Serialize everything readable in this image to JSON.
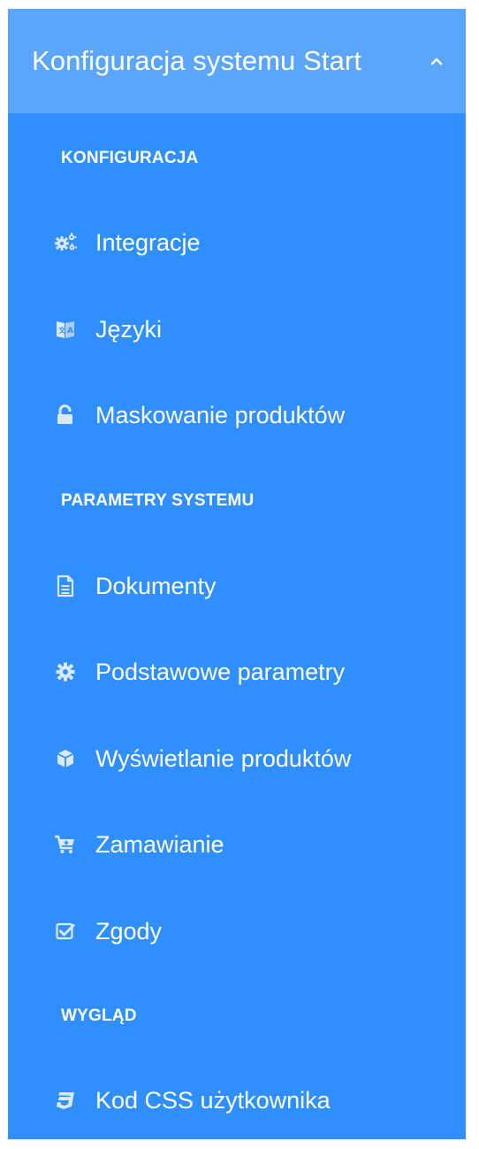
{
  "panel": {
    "title": "Konfiguracja systemu Start",
    "expanded": true,
    "chevron_icon": "chevron-up-icon",
    "colors": {
      "background": "#2f8ffd",
      "header_background": "#5aa6fd",
      "text": "#ffffff",
      "icon": "#dbe9ff"
    }
  },
  "sections": [
    {
      "label": "KONFIGURACJA",
      "items": [
        {
          "label": "Integracje",
          "icon": "gears-icon"
        },
        {
          "label": "Języki",
          "icon": "language-icon"
        },
        {
          "label": "Maskowanie produktów",
          "icon": "unlock-icon"
        }
      ]
    },
    {
      "label": "PARAMETRY SYSTEMU",
      "items": [
        {
          "label": "Dokumenty",
          "icon": "document-icon"
        },
        {
          "label": "Podstawowe parametry",
          "icon": "gear-icon"
        },
        {
          "label": "Wyświetlanie produktów",
          "icon": "cube-icon"
        },
        {
          "label": "Zamawianie",
          "icon": "cart-icon"
        },
        {
          "label": "Zgody",
          "icon": "checkbox-icon"
        }
      ]
    },
    {
      "label": "WYGLĄD",
      "items": [
        {
          "label": "Kod CSS użytkownika",
          "icon": "css3-icon"
        }
      ]
    }
  ]
}
